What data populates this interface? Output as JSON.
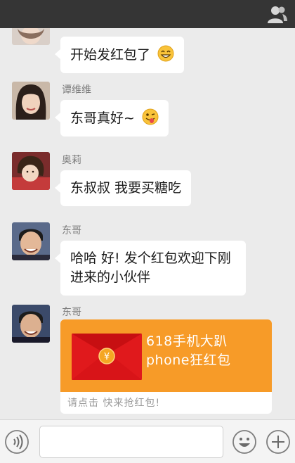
{
  "header": {
    "contacts_icon": "contacts-icon"
  },
  "messages": [
    {
      "name": "",
      "text": "开始发红包了",
      "emoji": "smile-emoji"
    },
    {
      "name": "谭维维",
      "text": "东哥真好~",
      "emoji": "tongue-wink-emoji"
    },
    {
      "name": "奥莉",
      "text": "东叔叔 我要买糖吃"
    },
    {
      "name": "东哥",
      "text": "哈哈 好! 发个红包欢迎下刚进来的小伙伴"
    },
    {
      "name": "东哥"
    }
  ],
  "red_packet": {
    "title_line1": "618手机大趴",
    "title_line2": "phone狂红包",
    "hint": "请点击 快来抢红包!",
    "symbol": "¥",
    "colors": {
      "card": "#f79b28",
      "envelope": "#e0191c"
    }
  },
  "input_bar": {
    "voice_icon": "voice-icon",
    "emoji_icon": "emoji-icon",
    "plus_icon": "plus-icon",
    "value": ""
  }
}
